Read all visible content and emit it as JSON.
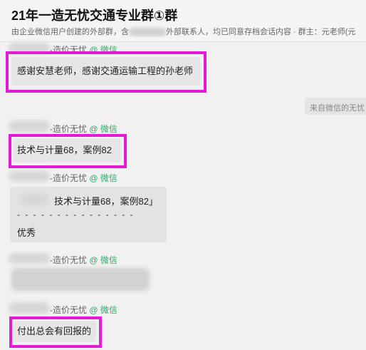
{
  "header": {
    "title": "21年一造无忧交通专业群①群",
    "subtitle_a": "由企业微信用户创建的外部群，含",
    "subtitle_b": "外部联系人，均已同意存档会话内容 · 群主：元老师(元",
    "members_blurred": "member-count-redacted"
  },
  "system_notice": "来自微信的无忧",
  "sender_suffix": "-造价无忧",
  "corp_tag": "@ 微信",
  "messages": [
    {
      "text": "感谢安慧老师，感谢交通运输工程的孙老师"
    },
    {
      "text": "技术与计量68，案例82"
    },
    {
      "quote": "技术与计量68，案例82」",
      "divider": "- - - - - - - - - - - - - - -",
      "reply": "优秀"
    },
    {
      "blurred": true
    },
    {
      "text": "付出总会有回报的"
    }
  ],
  "colors": {
    "highlight": "#e31bd6",
    "bubble": "#e6e6e6",
    "corp_tag": "#2aae67"
  }
}
